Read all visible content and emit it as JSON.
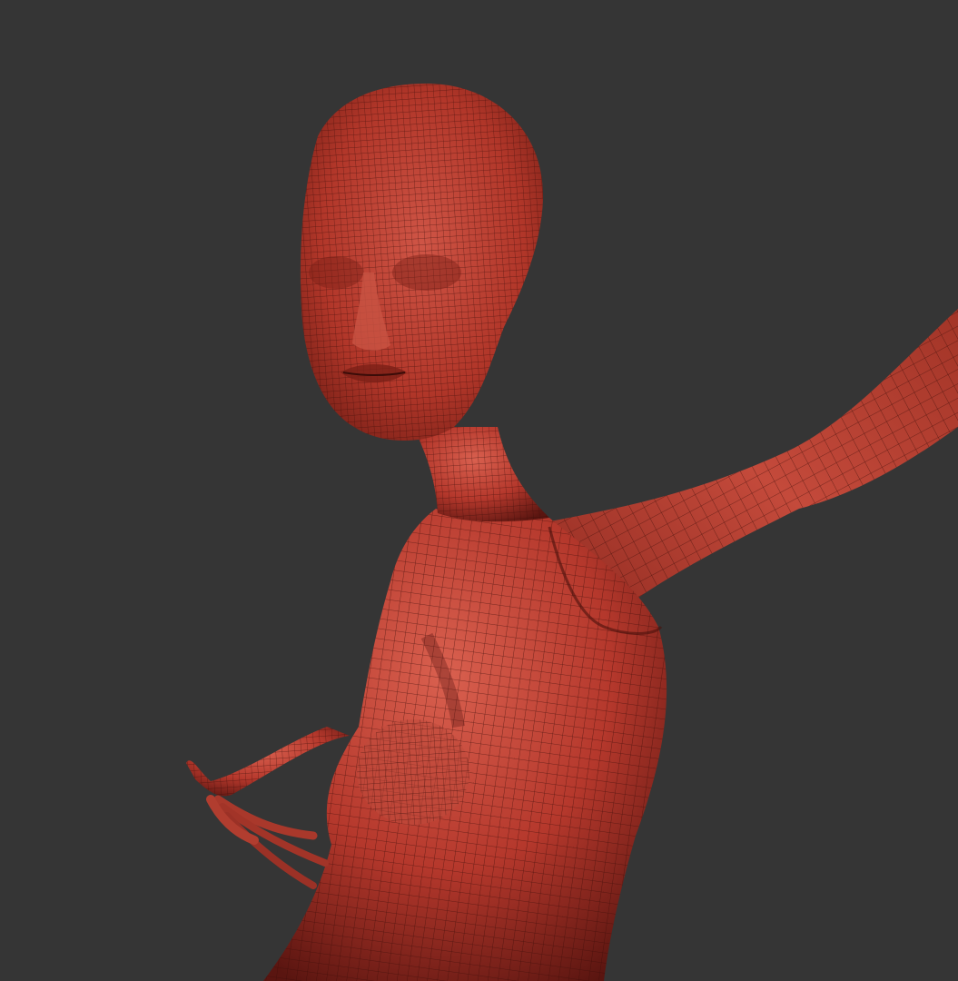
{
  "viewport": {
    "background_color": "#353535"
  },
  "model": {
    "material_color": "#b5382c",
    "highlight_color": "#d9604f",
    "shadow_color": "#5a1510",
    "wire_color": "#3a0c08",
    "display_mode": "wireframe-on-shaded",
    "parts": [
      "head",
      "face",
      "neck",
      "torso",
      "right-arm",
      "left-hand"
    ]
  }
}
